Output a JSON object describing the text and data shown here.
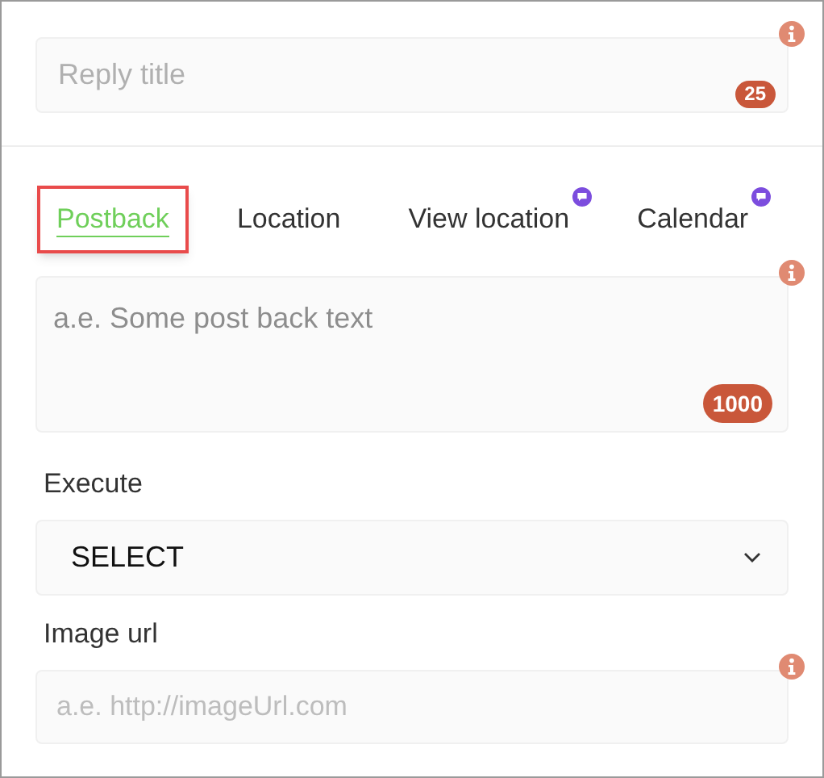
{
  "reply_title": {
    "placeholder": "Reply title",
    "counter": "25"
  },
  "tabs": [
    {
      "label": "Postback",
      "selected": true,
      "badge": false
    },
    {
      "label": "Location",
      "selected": false,
      "badge": false
    },
    {
      "label": "View location",
      "selected": false,
      "badge": true
    },
    {
      "label": "Calendar",
      "selected": false,
      "badge": true
    }
  ],
  "postback": {
    "placeholder": "a.e. Some post back text",
    "counter": "1000"
  },
  "execute": {
    "label": "Execute",
    "value": "SELECT"
  },
  "image_url": {
    "label": "Image url",
    "placeholder": "a.e. http://imageUrl.com"
  }
}
